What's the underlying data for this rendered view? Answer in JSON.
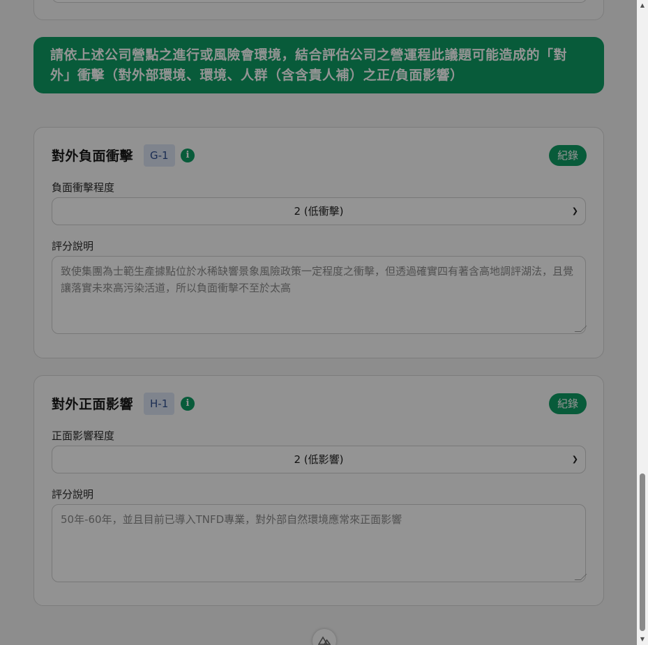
{
  "banner": {
    "line1": "請依上述公司營點之進行或風險會環境，結合評估公司之營運程此議題可能造成的「對",
    "line2": "外」衝擊（對外部環境、環境、人群（含含責人補）之正/負面影響）"
  },
  "negative_card": {
    "title": "對外負面衝擊",
    "code": "G-1",
    "info_glyph": "i",
    "record_label": "紀錄",
    "level_label": "負面衝擊程度",
    "level_value": "2 (低衝擊)",
    "explain_label": "評分說明",
    "explain_text": "致使集團為士範生產據點位於水稀缺響景象風險政策一定程度之衝擊，但透過確實四有著含高地調評湖法，且覺讓落實未來高污染活道，所以負面衝擊不至於太高"
  },
  "positive_card": {
    "title": "對外正面影響",
    "code": "H-1",
    "info_glyph": "i",
    "record_label": "紀錄",
    "level_label": "正面影響程度",
    "level_value": "2 (低影響)",
    "explain_label": "評分說明",
    "explain_text": "50年-60年，並且目前已導入TNFD專業，對外部自然環境應常來正面影響"
  },
  "fab": {
    "icon": "nuxt-logo-icon"
  },
  "scrollbar": {
    "up_glyph": "▲",
    "down_glyph": "▼"
  },
  "colors": {
    "accent": "#0f9d64",
    "badge_bg": "#dbe4f3",
    "badge_text": "#2f4f8f"
  }
}
